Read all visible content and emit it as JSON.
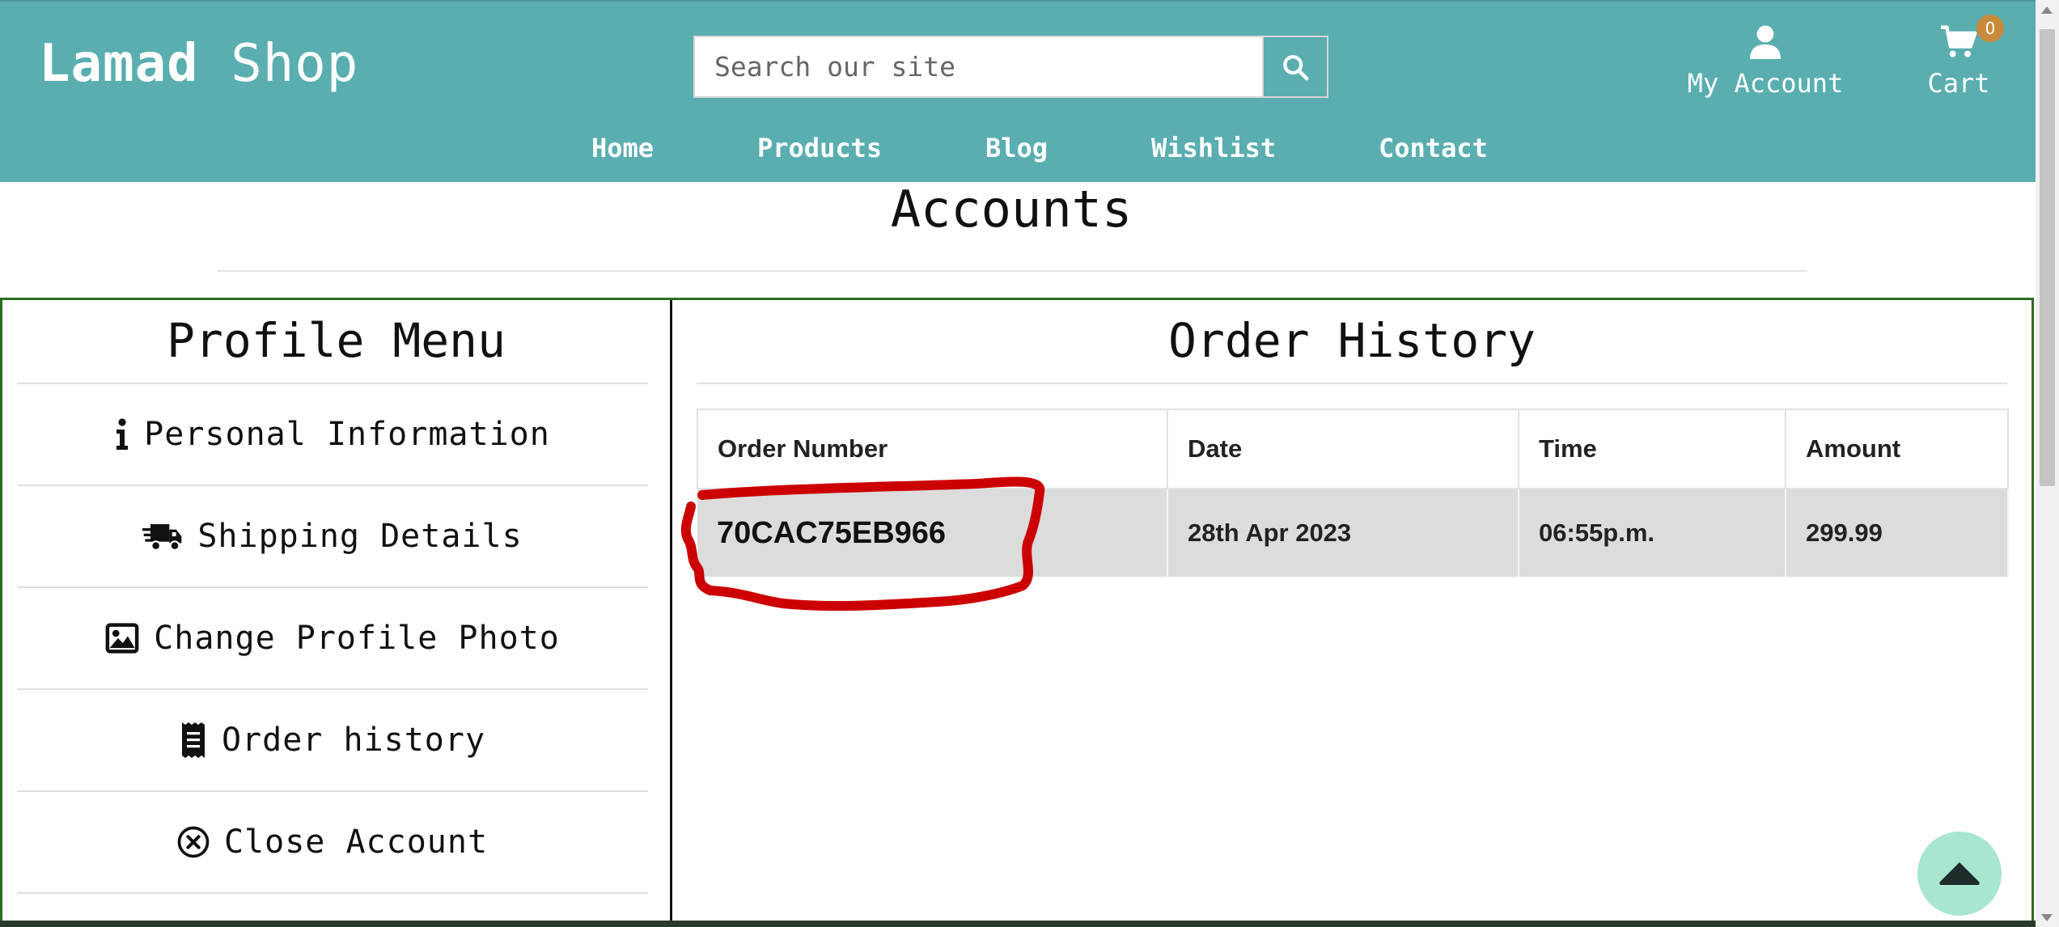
{
  "header": {
    "brand_bold": "Lamad",
    "brand_rest": " Shop",
    "search_placeholder": "Search our site",
    "account_label": "My Account",
    "cart_label": "Cart",
    "cart_count": "0"
  },
  "nav": {
    "items": [
      {
        "label": "Home"
      },
      {
        "label": "Products"
      },
      {
        "label": "Blog"
      },
      {
        "label": "Wishlist"
      },
      {
        "label": "Contact"
      }
    ]
  },
  "page": {
    "title": "Accounts"
  },
  "sidebar": {
    "title": "Profile Menu",
    "items": [
      {
        "label": "Personal Information",
        "icon": "info-icon"
      },
      {
        "label": "Shipping Details",
        "icon": "shipping-truck-icon"
      },
      {
        "label": "Change Profile Photo",
        "icon": "image-icon"
      },
      {
        "label": "Order history",
        "icon": "receipt-icon"
      },
      {
        "label": "Close Account",
        "icon": "close-circle-icon"
      }
    ]
  },
  "orders": {
    "title": "Order History",
    "columns": [
      "Order Number",
      "Date",
      "Time",
      "Amount"
    ],
    "rows": [
      {
        "order_number": "70CAC75EB966",
        "date": "28th Apr 2023",
        "time": "06:55p.m.",
        "amount": "299.99"
      }
    ]
  },
  "colors": {
    "header_bg": "#5aaeb0",
    "panel_border": "#2c6e20",
    "annotation": "#cc0000",
    "to_top_bg": "#a8e6cf"
  }
}
